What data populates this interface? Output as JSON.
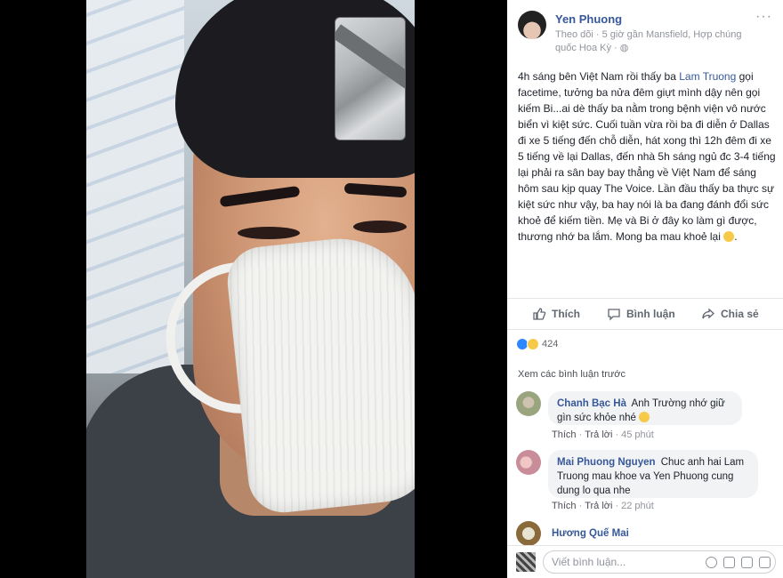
{
  "post": {
    "author": "Yen Phuong",
    "follow": "Theo dõi",
    "meta": "· 5 giờ gần Mansfield, Hợp chúng quốc Hoa Kỳ ·",
    "more": "···",
    "text_before_tag": "4h sáng bên Việt Nam rồi thấy ba ",
    "tag": "Lam Truong",
    "text_after_tag": " gọi facetime, tưởng ba nửa đêm giựt mình dậy nên gọi kiếm Bi...ai dè thấy ba nằm trong bệnh viện vô nước biển vì kiệt sức. Cuối tuần vừa rồi ba đi diễn ở Dallas đi xe 5 tiếng đến chỗ diễn, hát xong thì 12h đêm đi xe 5 tiếng về lại Dallas, đến nhà 5h sáng ngủ đc 3-4 tiếng lại phải ra sân bay bay thẳng về Việt Nam để sáng hôm sau kịp quay The Voice. Lần đầu thấy ba thực sự kiệt sức như vậy, ba hay nói là ba đang đánh đổi sức khoẻ để kiếm tiền. Mẹ và Bi ở đây ko làm gì được, thương nhớ ba lắm. Mong ba mau khoẻ lại "
  },
  "actions": {
    "like": "Thích",
    "comment": "Bình luận",
    "share": "Chia sẻ"
  },
  "reactions": {
    "count": "424"
  },
  "comments_section": {
    "view_previous": "Xem các bình luận trước"
  },
  "comments": [
    {
      "name": "Chanh Bạc Hà",
      "text": "Anh Trường nhớ giữ gìn sức khỏe nhé",
      "like": "Thích",
      "reply": "Trả lời",
      "time": "45 phút"
    },
    {
      "name": "Mai Phuong Nguyen",
      "text": "Chuc anh hai Lam Truong mau khoe va Yen Phuong cung dung lo qua nhe",
      "like": "Thích",
      "reply": "Trả lời",
      "time": "22 phút"
    },
    {
      "name": "Hương Quế Mai"
    }
  ],
  "composer": {
    "placeholder": "Viết bình luận..."
  },
  "colors": {
    "link": "#365899",
    "muted": "#90949c",
    "bubble": "#f2f3f5"
  }
}
